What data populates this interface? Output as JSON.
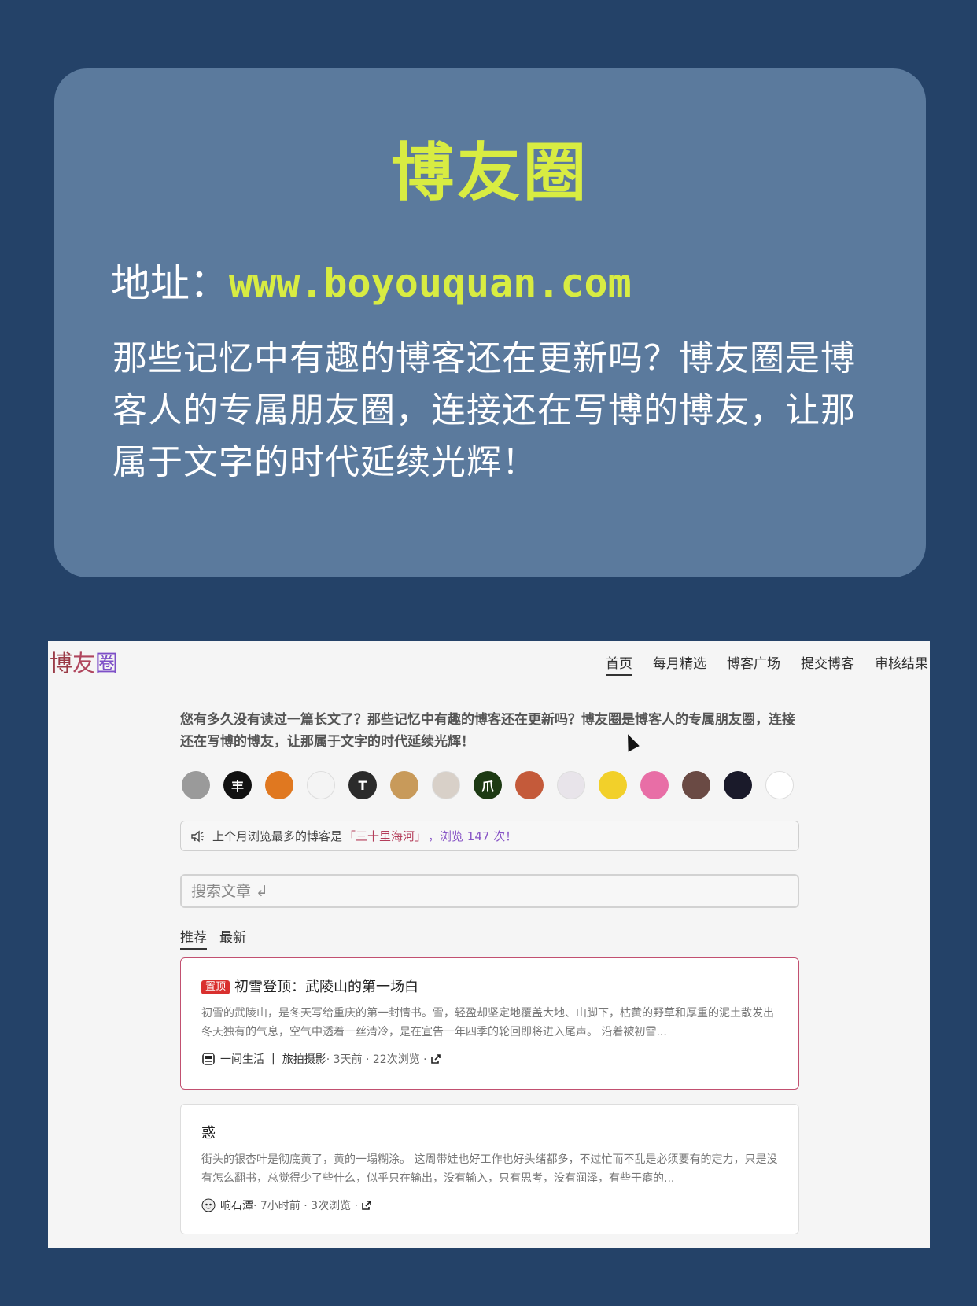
{
  "promo": {
    "title": "博友圈",
    "address_label": "地址：",
    "address_url": "www.boyouquan.com",
    "description": "那些记忆中有趣的博客还在更新吗？博友圈是博客人的专属朋友圈，连接还在写博的博友，让那属于文字的时代延续光辉！"
  },
  "site": {
    "logo": [
      "博",
      "友",
      "圈"
    ],
    "nav": [
      "首页",
      "每月精选",
      "博客广场",
      "提交博客",
      "审核结果"
    ],
    "intro": "您有多久没有读过一篇长文了？那些记忆中有趣的博客还在更新吗？博友圈是博客人的专属朋友圈，连接还在写博的博友，让那属于文字的时代延续光辉！",
    "avatars": [
      {
        "name": "avatar-1",
        "bg": "#9a9a9a",
        "glyph": ""
      },
      {
        "name": "avatar-2",
        "bg": "#111111",
        "glyph": "丰"
      },
      {
        "name": "avatar-3",
        "bg": "#e07820",
        "glyph": ""
      },
      {
        "name": "avatar-4",
        "bg": "#f4f4f4",
        "glyph": ""
      },
      {
        "name": "avatar-5",
        "bg": "#2b2b2b",
        "glyph": "T"
      },
      {
        "name": "avatar-6",
        "bg": "#c89a5a",
        "glyph": ""
      },
      {
        "name": "avatar-7",
        "bg": "#d8d0c8",
        "glyph": ""
      },
      {
        "name": "avatar-8",
        "bg": "#1d3a14",
        "glyph": "爪"
      },
      {
        "name": "avatar-9",
        "bg": "#c45a3a",
        "glyph": ""
      },
      {
        "name": "avatar-10",
        "bg": "#e8e4ea",
        "glyph": ""
      },
      {
        "name": "avatar-11",
        "bg": "#f2d02a",
        "glyph": ""
      },
      {
        "name": "avatar-12",
        "bg": "#e86ea6",
        "glyph": ""
      },
      {
        "name": "avatar-13",
        "bg": "#6a4a44",
        "glyph": ""
      },
      {
        "name": "avatar-14",
        "bg": "#1a1a2a",
        "glyph": ""
      },
      {
        "name": "avatar-15",
        "bg": "#ffffff",
        "glyph": ""
      }
    ],
    "notice": {
      "prefix": "上个月浏览最多的博客是",
      "blog_name": "「三十里海河」",
      "suffix": "，浏览 147 次！"
    },
    "search_placeholder": "搜索文章 ↲",
    "tabs": [
      "推荐",
      "最新"
    ],
    "posts": [
      {
        "pinned": true,
        "badge": "置顶",
        "title": "初雪登顶：武陵山的第一场白",
        "excerpt": "初雪的武陵山，是冬天写给重庆的第一封情书。雪，轻盈却坚定地覆盖大地、山脚下，枯黄的野草和厚重的泥土散发出冬天独有的气息，空气中透着一丝清冷，是在宣告一年四季的轮回即将进入尾声。 沿着被初雪...",
        "author": "一间生活",
        "separator": "|",
        "category": "旅拍摄影",
        "meta": "· 3天前 · 22次浏览 ·"
      },
      {
        "pinned": false,
        "title": "惑",
        "excerpt": "街头的银杏叶是彻底黄了，黄的一塌糊涂。 这周带娃也好工作也好头绪都多，不过忙而不乱是必须要有的定力，只是没有怎么翻书，总觉得少了些什么，似乎只在输出，没有输入，只有思考，没有润泽，有些干瘪的...",
        "author": "响石潭",
        "meta": "· 7小时前 · 3次浏览 ·"
      }
    ]
  }
}
